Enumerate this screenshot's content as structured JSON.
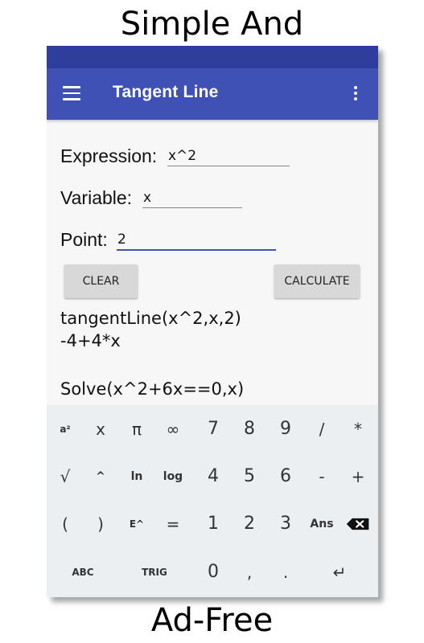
{
  "banner": {
    "top": "Simple And",
    "bottom": "Ad-Free"
  },
  "appbar": {
    "title": "Tangent Line",
    "menu_icon": "hamburger-menu-icon",
    "overflow_icon": "more-vert-icon"
  },
  "form": {
    "expression_label": "Expression:",
    "expression_value": "x^2",
    "variable_label": "Variable:",
    "variable_value": "x",
    "point_label": "Point:",
    "point_value": "2"
  },
  "buttons": {
    "clear": "CLEAR",
    "calculate": "CALCULATE"
  },
  "output": {
    "line1": "tangentLine(x^2,x,2)",
    "line2": "-4+4*x",
    "line3": "Solve(x^2+6x==0,x)"
  },
  "keyboard": {
    "row1": [
      "a²",
      "x",
      "π",
      "∞",
      "7",
      "8",
      "9",
      "/",
      "*"
    ],
    "row2": [
      "√",
      "^",
      "ln",
      "log",
      "4",
      "5",
      "6",
      "-",
      "+"
    ],
    "row3": [
      "(",
      ")",
      "E^",
      "=",
      "1",
      "2",
      "3",
      "Ans"
    ],
    "row3_backspace_icon": "backspace-icon",
    "row4": {
      "abc": "ABC",
      "trig": "TRIG",
      "zero": "0",
      "comma": ",",
      "dot": ".",
      "enter": "↵"
    }
  },
  "colors": {
    "primary": "#3f51b5",
    "primary_dark": "#2f3e9c",
    "keyboard_bg": "#eceff1"
  }
}
